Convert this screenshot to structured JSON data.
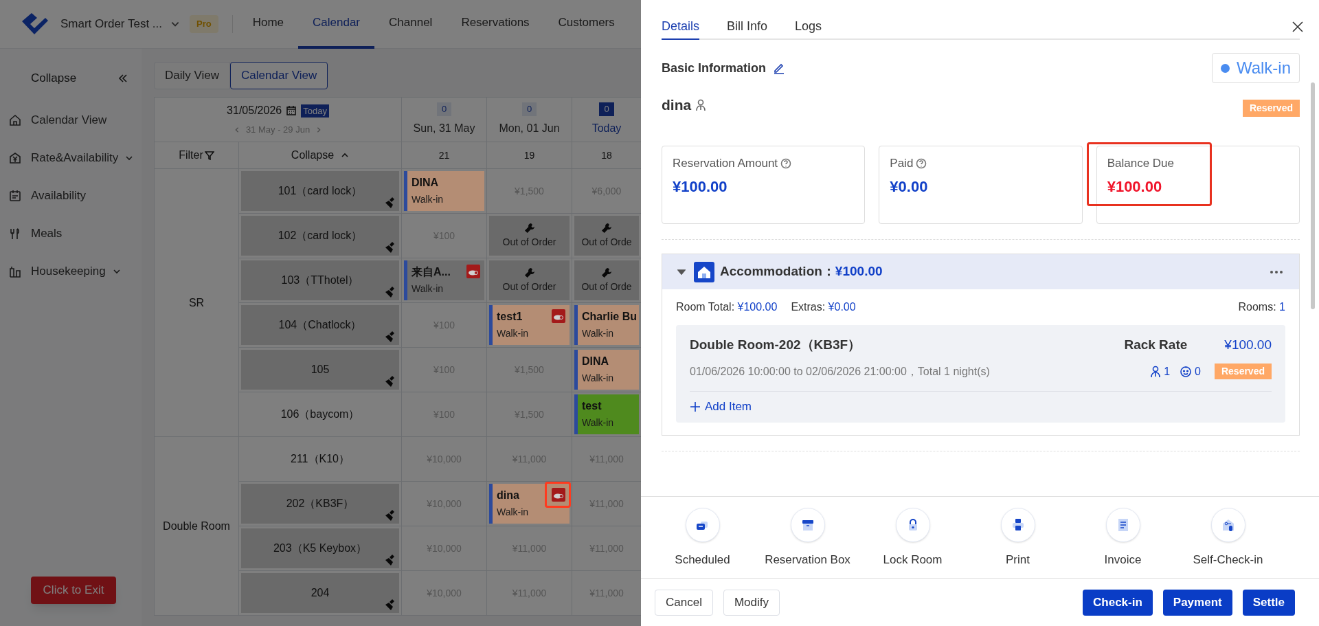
{
  "header": {
    "brand": "Smart Order Test ...",
    "plan": "Pro",
    "nav": [
      {
        "label": "Home",
        "selected": false
      },
      {
        "label": "Calendar",
        "selected": true
      },
      {
        "label": "Channel",
        "selected": false
      },
      {
        "label": "Reservations",
        "selected": false
      },
      {
        "label": "Customers",
        "selected": false
      }
    ]
  },
  "sidebar": {
    "collapse": "Collapse",
    "items": [
      {
        "label": "Calendar View",
        "expandable": false
      },
      {
        "label": "Rate&Availability",
        "expandable": true
      },
      {
        "label": "Availability",
        "expandable": false
      },
      {
        "label": "Meals",
        "expandable": false
      },
      {
        "label": "Housekeeping",
        "expandable": true
      }
    ],
    "exit_button": "Click to Exit"
  },
  "view_tabs": [
    {
      "label": "Daily View",
      "selected": false
    },
    {
      "label": "Calendar View",
      "selected": true
    }
  ],
  "calendar": {
    "date": "31/05/2026",
    "today_button": "Today",
    "range": "31 May - 29 Jun",
    "filter": "Filter",
    "collapse": "Collapse",
    "days": [
      {
        "count": "0",
        "label": "Sun, 31 May",
        "today": false,
        "available": "21"
      },
      {
        "count": "0",
        "label": "Mon, 01 Jun",
        "today": false,
        "available": "19"
      },
      {
        "count": "0",
        "label": "Today",
        "today": true,
        "available": "18"
      }
    ],
    "groups": [
      {
        "name": "SR",
        "rooms": [
          {
            "name": "101（card lock）",
            "dirty": true,
            "cells": [
              {
                "kind": "booking",
                "name": "DINA",
                "source": "Walk-in",
                "color": "#b48d74",
                "flagged": false,
                "highlighted": false
              },
              {
                "kind": "price",
                "text": "¥1,500"
              },
              {
                "kind": "price",
                "text": "¥6,000"
              }
            ]
          },
          {
            "name": "102（card lock）",
            "dirty": true,
            "cells": [
              {
                "kind": "price",
                "text": "¥100"
              },
              {
                "kind": "out_of_order",
                "text": "Out of Order"
              },
              {
                "kind": "out_of_order",
                "text": "Out of Orde"
              }
            ]
          },
          {
            "name": "103（TThotel）",
            "dirty": true,
            "cells": [
              {
                "kind": "booking",
                "name": "来自A...",
                "source": "Walk-in",
                "color": "#6e6e6e",
                "flagged": true,
                "highlighted": false
              },
              {
                "kind": "out_of_order",
                "text": "Out of Order"
              },
              {
                "kind": "out_of_order",
                "text": "Out of Orde"
              }
            ]
          },
          {
            "name": "104（Chatlock）",
            "dirty": true,
            "cells": [
              {
                "kind": "price",
                "text": "¥100"
              },
              {
                "kind": "booking",
                "name": "test1",
                "source": "Walk-in",
                "color": "#b48d74",
                "flagged": true,
                "highlighted": false
              },
              {
                "kind": "booking",
                "name": "Charlie Bu",
                "source": "Walk-in",
                "color": "#b48d74",
                "flagged": false,
                "highlighted": false
              }
            ]
          },
          {
            "name": "105",
            "dirty": true,
            "cells": [
              {
                "kind": "price",
                "text": "¥100"
              },
              {
                "kind": "price",
                "text": "¥1,500"
              },
              {
                "kind": "booking",
                "name": "DINA",
                "source": "Walk-in",
                "color": "#b48d74",
                "flagged": false,
                "highlighted": false
              }
            ]
          },
          {
            "name": "106（baycom）",
            "dirty": false,
            "cells": [
              {
                "kind": "price",
                "text": "¥100"
              },
              {
                "kind": "price",
                "text": "¥1,500"
              },
              {
                "kind": "booking",
                "name": "test",
                "source": "Walk-in",
                "color": "#4f8a1e",
                "flagged": false,
                "highlighted": false
              }
            ]
          }
        ]
      },
      {
        "name": "Double Room",
        "rooms": [
          {
            "name": "211（K10）",
            "dirty": false,
            "cells": [
              {
                "kind": "price",
                "text": "¥10,000"
              },
              {
                "kind": "price",
                "text": "¥11,000"
              },
              {
                "kind": "price",
                "text": "¥11,000"
              }
            ]
          },
          {
            "name": "202（KB3F）",
            "dirty": true,
            "cells": [
              {
                "kind": "price",
                "text": "¥10,000"
              },
              {
                "kind": "booking",
                "name": "dina",
                "source": "Walk-in",
                "color": "#b48d74",
                "flagged": true,
                "highlighted": true
              },
              {
                "kind": "price",
                "text": "¥11,000"
              }
            ]
          },
          {
            "name": "203（K5 Keybox）",
            "dirty": true,
            "cells": [
              {
                "kind": "price",
                "text": "¥10,000"
              },
              {
                "kind": "price",
                "text": "¥11,000"
              },
              {
                "kind": "price",
                "text": "¥11,000"
              }
            ]
          },
          {
            "name": "204",
            "dirty": true,
            "cells": [
              {
                "kind": "price",
                "text": "¥10,000"
              },
              {
                "kind": "price",
                "text": "¥11,000"
              },
              {
                "kind": "price",
                "text": "¥11,000"
              }
            ]
          }
        ]
      }
    ]
  },
  "drawer": {
    "tabs": [
      {
        "label": "Details",
        "selected": true
      },
      {
        "label": "Bill Info",
        "selected": false
      },
      {
        "label": "Logs",
        "selected": false
      }
    ],
    "section_title": "Basic Information",
    "source": "Walk-in",
    "guest": "dina",
    "status": "Reserved",
    "summary": [
      {
        "label": "Reservation Amount",
        "help": true,
        "value": "¥100.00",
        "kind": "amount",
        "highlighted": false
      },
      {
        "label": "Paid",
        "help": true,
        "value": "¥0.00",
        "kind": "amount",
        "highlighted": false
      },
      {
        "label": "Balance Due",
        "help": false,
        "value": "¥100.00",
        "kind": "balance",
        "highlighted": true
      }
    ],
    "accommodation": {
      "title": "Accommodation：",
      "amount": "¥100.00",
      "expanded": true,
      "room_total_label": "Room Total:",
      "room_total": "¥100.00",
      "extras_label": "Extras:",
      "extras": "¥0.00",
      "rooms_label": "Rooms:",
      "rooms": "1",
      "room": {
        "name": "Double Room-202（KB3F）",
        "rate_label": "Rack Rate",
        "rate": "¥100.00",
        "dates": "01/06/2026 10:00:00 to 02/06/2026 21:00:00，Total 1 night(s)",
        "adults": "1",
        "children": "0",
        "status": "Reserved"
      },
      "add_item": "Add Item"
    },
    "actions": [
      {
        "label": "Scheduled"
      },
      {
        "label": "Reservation Box"
      },
      {
        "label": "Lock Room"
      },
      {
        "label": "Print"
      },
      {
        "label": "Invoice"
      },
      {
        "label": "Self-Check-in"
      }
    ],
    "footer_buttons": [
      {
        "label": "Cancel",
        "kind": "outline"
      },
      {
        "label": "Modify",
        "kind": "outline"
      },
      {
        "label": "Check-in",
        "kind": "primary"
      },
      {
        "label": "Payment",
        "kind": "primary"
      },
      {
        "label": "Settle",
        "kind": "primary"
      }
    ]
  }
}
